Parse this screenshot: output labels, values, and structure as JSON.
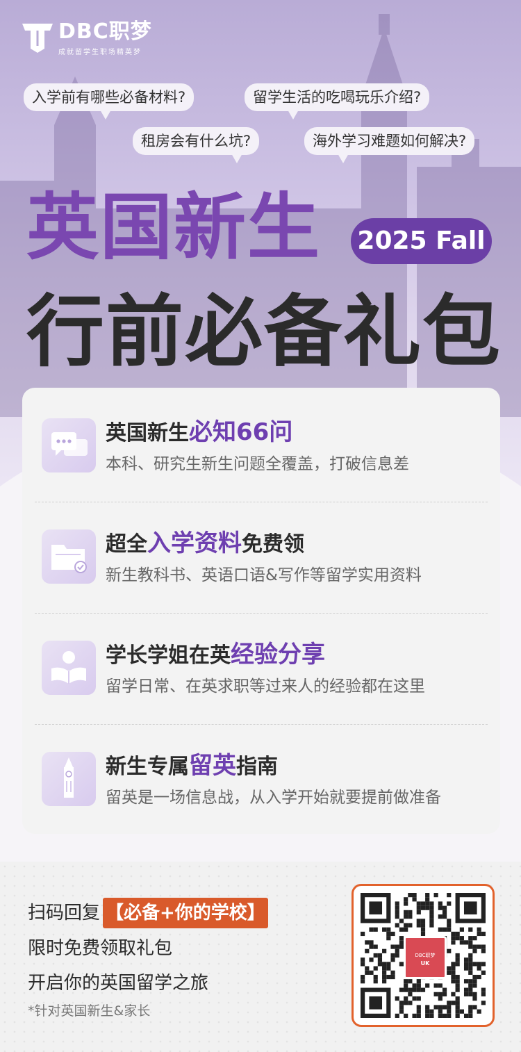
{
  "brand": {
    "name": "DBC职梦",
    "tagline": "成就留学生职场精英梦"
  },
  "questions": [
    "入学前有哪些必备材料?",
    "留学生活的吃喝玩乐介绍?",
    "租房会有什么坑?",
    "海外学习难题如何解决?"
  ],
  "hero": {
    "title_line1": "英国新生",
    "season_badge": "2025 Fall",
    "title_line2": "行前必备礼包"
  },
  "items": [
    {
      "icon": "chat-bubbles-icon",
      "prefix": "英国新生",
      "highlight": "必知66问",
      "suffix": "",
      "desc": "本科、研究生新生问题全覆盖，打破信息差"
    },
    {
      "icon": "folder-icon",
      "prefix": "超全",
      "highlight": "入学资料",
      "suffix": "免费领",
      "desc": "新生教科书、英语口语&写作等留学实用资料"
    },
    {
      "icon": "reader-person-icon",
      "prefix": "学长学姐在英",
      "highlight": "经验分享",
      "suffix": "",
      "desc": "留学日常、在英求职等过来人的经验都在这里"
    },
    {
      "icon": "big-ben-icon",
      "prefix": "新生专属",
      "highlight": "留英",
      "suffix": "指南",
      "desc": "留英是一场信息战，从入学开始就要提前做准备"
    }
  ],
  "cta": {
    "line1": "扫码回复",
    "line1_badge": "【必备+你的学校】",
    "line2": "限时免费领取礼包",
    "line3": "开启你的英国留学之旅",
    "note": "*针对英国新生&家长"
  },
  "qr": {
    "center_name": "DBC职梦",
    "center_region": "UK"
  },
  "colors": {
    "accent": "#6e3fb0",
    "badge": "#6b3fa6",
    "cta": "#d95a2b"
  }
}
